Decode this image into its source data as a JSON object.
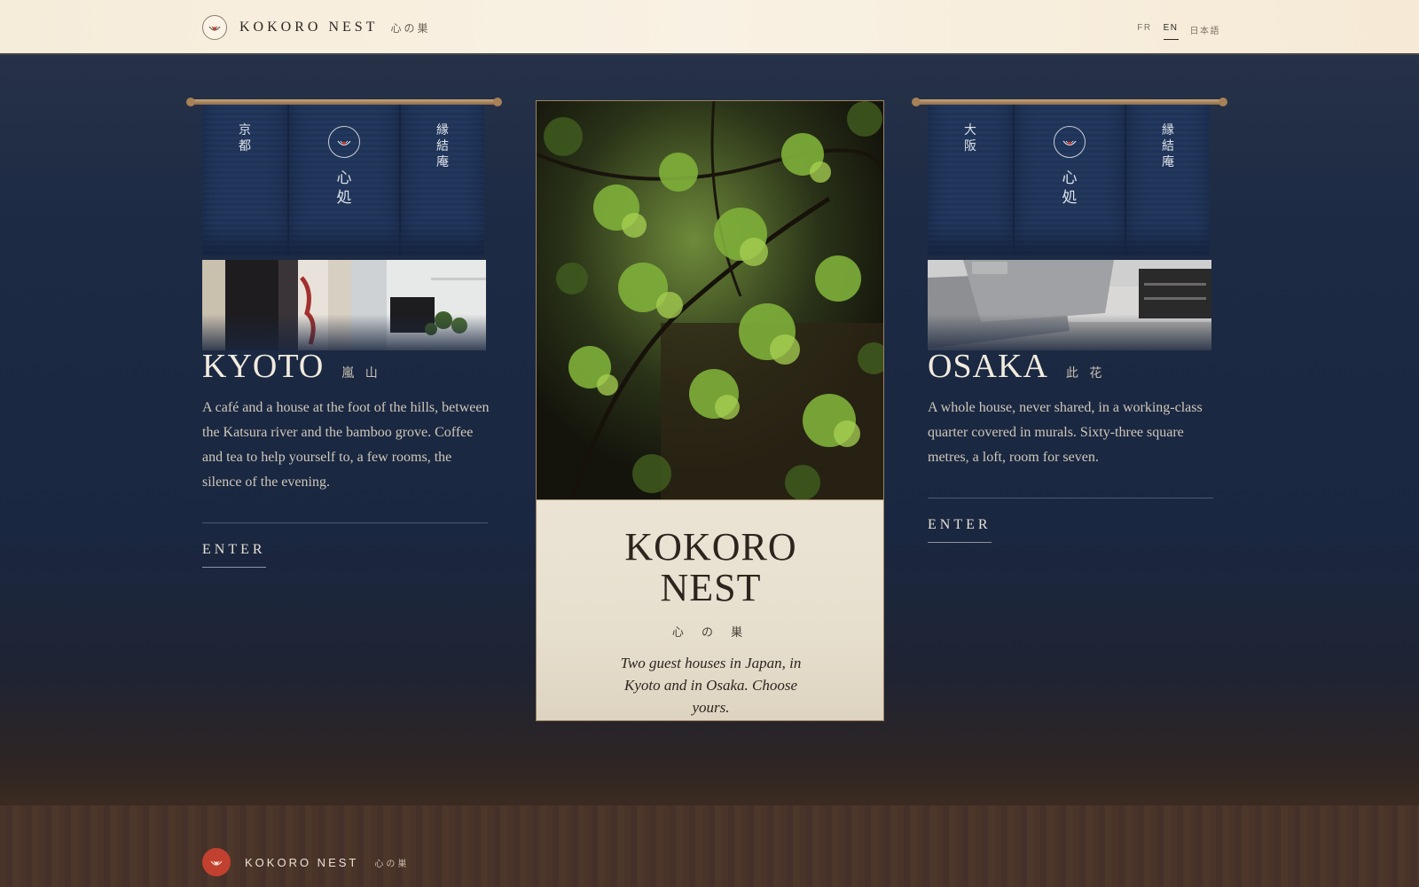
{
  "header": {
    "brand_name": "KOKORO NEST",
    "brand_jp": "心の巣",
    "languages": [
      {
        "label": "FR",
        "active": false
      },
      {
        "label": "EN",
        "active": true
      },
      {
        "label": "日本語",
        "active": false
      }
    ]
  },
  "kyoto": {
    "noren_left": [
      "京",
      "都"
    ],
    "noren_mid": [
      "心",
      "処"
    ],
    "noren_right": [
      "縁",
      "結",
      "庵"
    ],
    "city": "KYOTO",
    "city_jp": "嵐 山",
    "description": "A café and a house at the foot of the hills, between the Katsura river and the bamboo grove. Coffee and tea to help yourself to, a few rooms, the silence of the evening.",
    "cta": "ENTER"
  },
  "center": {
    "title_line1": "KOKORO",
    "title_line2": "NEST",
    "title_jp": "心 の 巣",
    "tagline": "Two guest houses in Japan, in Kyoto and in Osaka. Choose yours."
  },
  "osaka": {
    "noren_left": [
      "大",
      "阪"
    ],
    "noren_mid": [
      "心",
      "処"
    ],
    "noren_right": [
      "縁",
      "結",
      "庵"
    ],
    "city": "OSAKA",
    "city_jp": "此 花",
    "description": "A whole house, never shared, in a working-class quarter covered in murals. Sixty-three square metres, a loft, room for seven.",
    "cta": "ENTER"
  },
  "footer": {
    "brand_name": "KOKORO NEST",
    "brand_jp": "心の巣"
  },
  "colors": {
    "accent_red": "#c2402f",
    "navy": "#1c2a44",
    "cream": "#f6ecda"
  }
}
